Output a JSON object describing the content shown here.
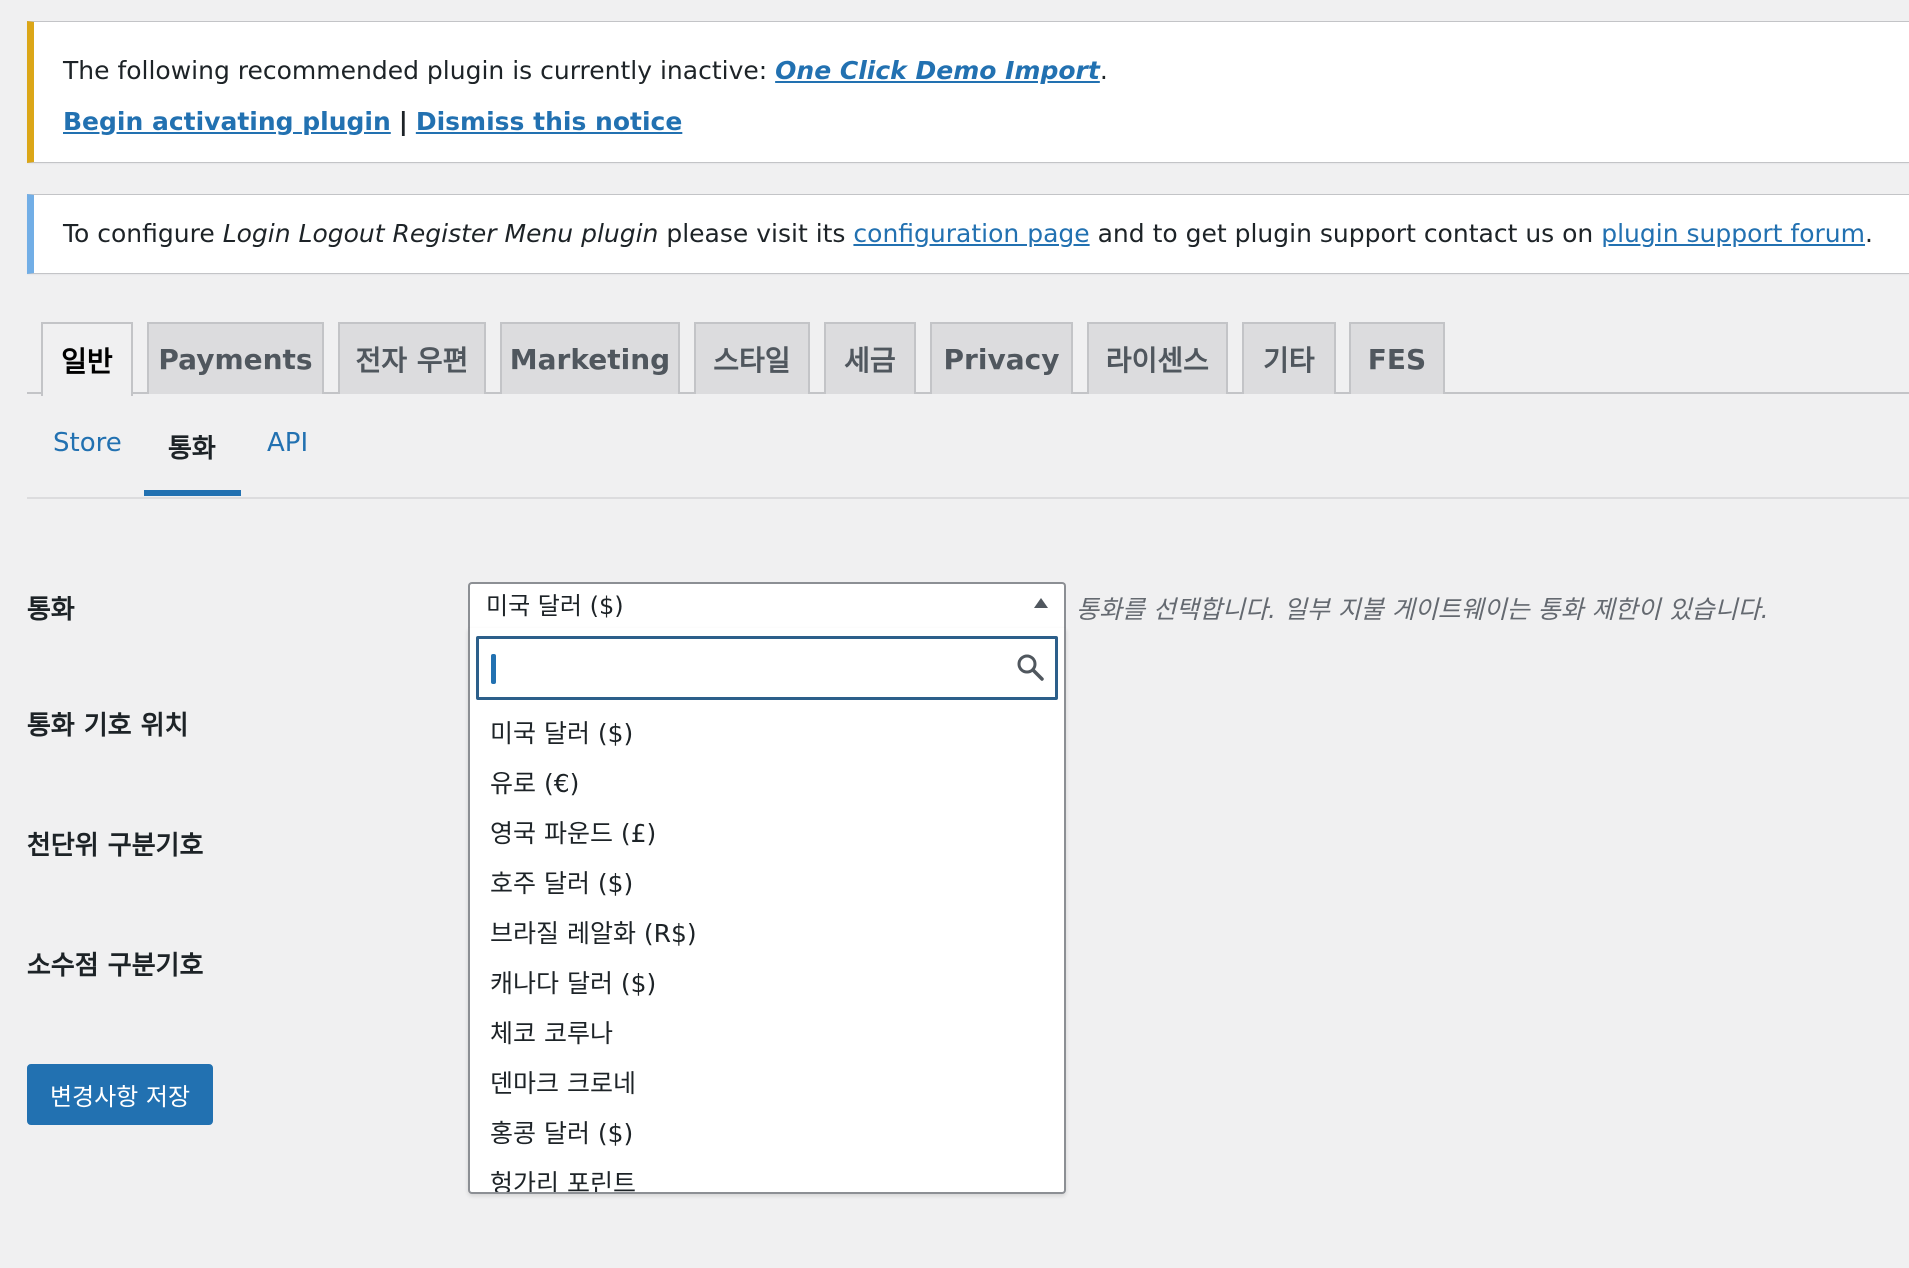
{
  "notices": {
    "plugin": {
      "text": "The following recommended plugin is currently inactive:",
      "plugin_link": "One Click Demo Import",
      "period": ".",
      "activate_link": "Begin activating plugin",
      "separator": "|",
      "dismiss_link": "Dismiss this notice"
    },
    "config": {
      "text_1": "To configure",
      "plugin_name": "Login Logout Register Menu plugin",
      "text_2": "please visit its",
      "config_link": "configuration page",
      "text_3": "and to get plugin support contact us on",
      "forum_link": "plugin support forum",
      "period": "."
    }
  },
  "tabs": [
    {
      "label": "일반",
      "active": true
    },
    {
      "label": "Payments"
    },
    {
      "label": "전자 우편"
    },
    {
      "label": "Marketing"
    },
    {
      "label": "스타일"
    },
    {
      "label": "세금"
    },
    {
      "label": "Privacy"
    },
    {
      "label": "라이센스"
    },
    {
      "label": "기타"
    },
    {
      "label": "FES"
    }
  ],
  "subtabs": [
    {
      "label": "Store"
    },
    {
      "label": "통화",
      "active": true
    },
    {
      "label": "API"
    }
  ],
  "form": {
    "currency_label": "통화",
    "symbol_position_label": "통화 기호 위치",
    "thousands_label": "천단위 구분기호",
    "decimal_label": "소수점 구분기호",
    "selected_currency": "미국 달러 ($)",
    "currency_help": "통화를 선택합니다. 일부 지불 게이트웨이는 통화 제한이 있습니다.",
    "search_value": "",
    "save_label": "변경사항 저장"
  },
  "currency_options": [
    "미국 달러 ($)",
    "유로 (€)",
    "영국 파운드 (£)",
    "호주 달러 ($)",
    "브라질 레알화 (R$)",
    "캐나다 달러 ($)",
    "체코 코루나",
    "덴마크 크로네",
    "홍콩 달러 ($)",
    "헝가리 포린트"
  ],
  "colors": {
    "accent": "#2271b1",
    "warning_border": "#dba617",
    "info_border": "#72aee6",
    "background": "#f0f0f1"
  },
  "icons": {
    "search": "search-icon",
    "dropdown_arrow": "caret-up-icon"
  }
}
